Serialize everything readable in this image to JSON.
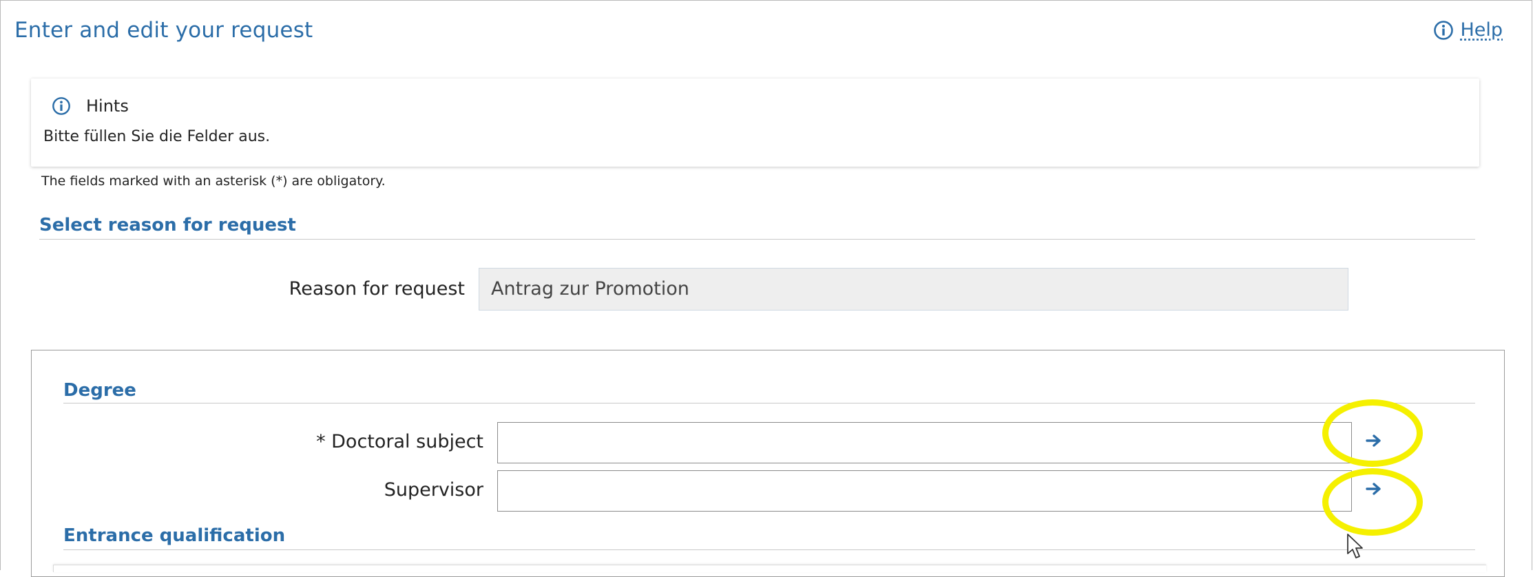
{
  "header": {
    "title": "Enter and edit your request",
    "help_label": "Help"
  },
  "hints": {
    "title": "Hints",
    "text": "Bitte füllen Sie die Felder aus."
  },
  "mandatory_note": "The fields marked with an asterisk (*) are obligatory.",
  "reason_section": {
    "heading": "Select reason for request",
    "label": "Reason for request",
    "value": "Antrag zur Promotion"
  },
  "degree_section": {
    "heading": "Degree",
    "fields": [
      {
        "label": "* Doctoral subject",
        "value": ""
      },
      {
        "label": "Supervisor",
        "value": ""
      }
    ]
  },
  "entrance_section": {
    "heading": "Entrance qualification"
  },
  "colors": {
    "accent": "#2b6da8",
    "highlight": "#f5f000",
    "readonly_bg": "#eeeeee"
  },
  "icons": [
    "info-icon",
    "arrow-right-icon",
    "mouse-pointer-icon"
  ]
}
